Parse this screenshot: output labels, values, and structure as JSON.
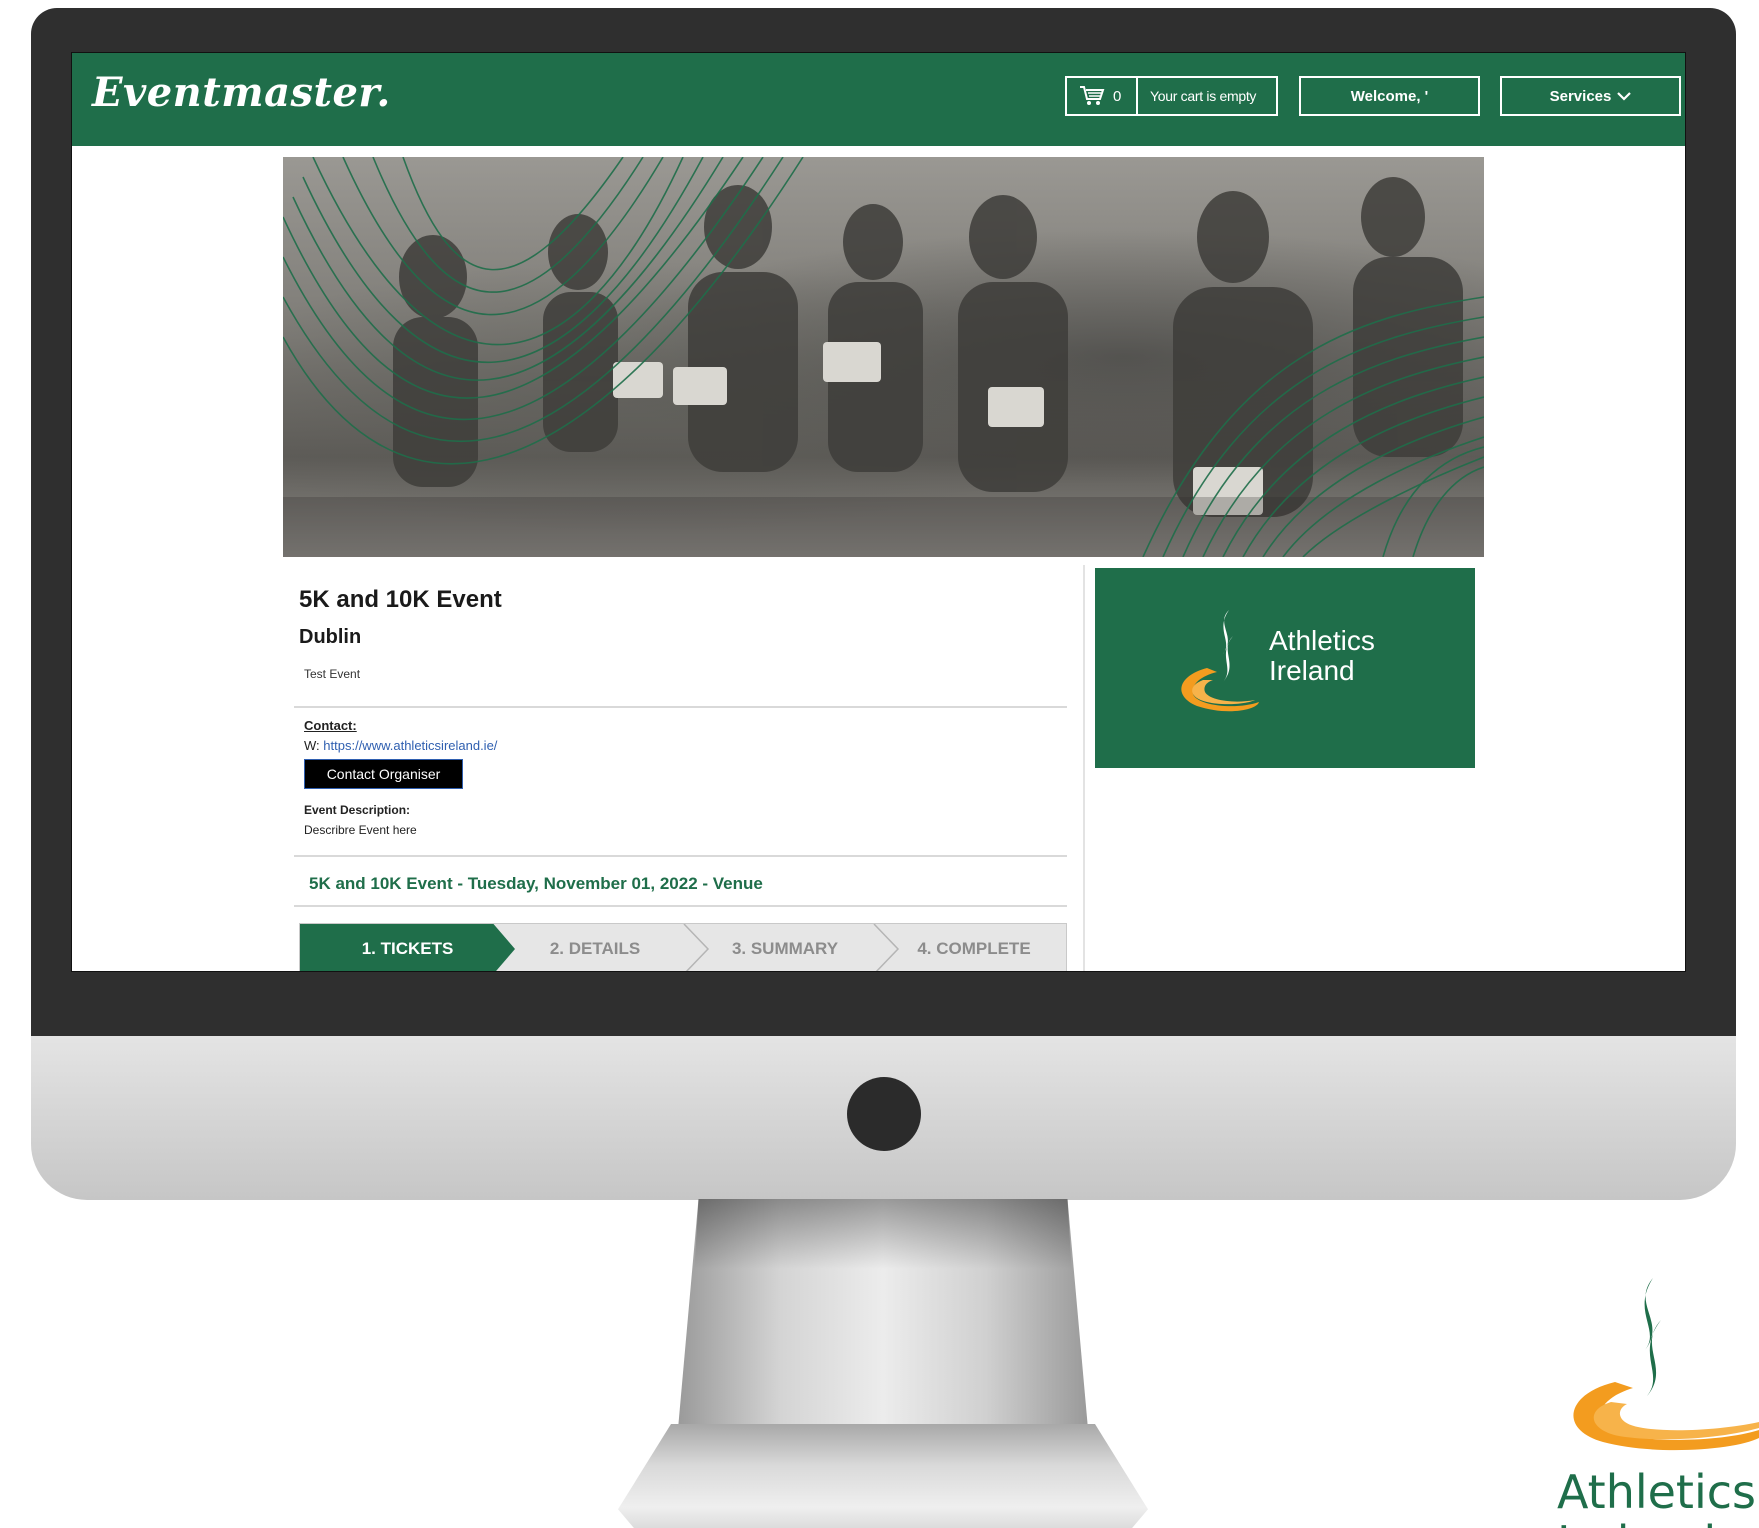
{
  "navbar": {
    "brand": "Eventmaster.",
    "cart_count": "0",
    "cart_text": "Your cart is empty",
    "welcome": "Welcome, '",
    "services": "Services",
    "accent_color": "#1f6e4a"
  },
  "event": {
    "title": "5K and 10K Event",
    "city": "Dublin",
    "subtitle": "Test Event",
    "contact_label": "Contact:",
    "web_prefix": "W:",
    "web_url": "https://www.athleticsireland.ie/",
    "contact_button": "Contact Organiser",
    "description_label": "Event Description:",
    "description_text": "Describre Event here",
    "session_line": "5K and 10K Event - Tuesday, November 01, 2022 - Venue"
  },
  "steps": [
    {
      "label": "1. TICKETS",
      "active": true
    },
    {
      "label": "2. DETAILS",
      "active": false
    },
    {
      "label": "3. SUMMARY",
      "active": false
    },
    {
      "label": "4. COMPLETE",
      "active": false
    }
  ],
  "organiser_logo": {
    "line1": "Athletics",
    "line2": "Ireland",
    "icon": "athletics-ireland-logo"
  },
  "corner_logo": {
    "line1": "Athletics",
    "line2": "Ireland",
    "icon": "athletics-ireland-logo"
  },
  "hero": {
    "icon": "runners-photo"
  }
}
